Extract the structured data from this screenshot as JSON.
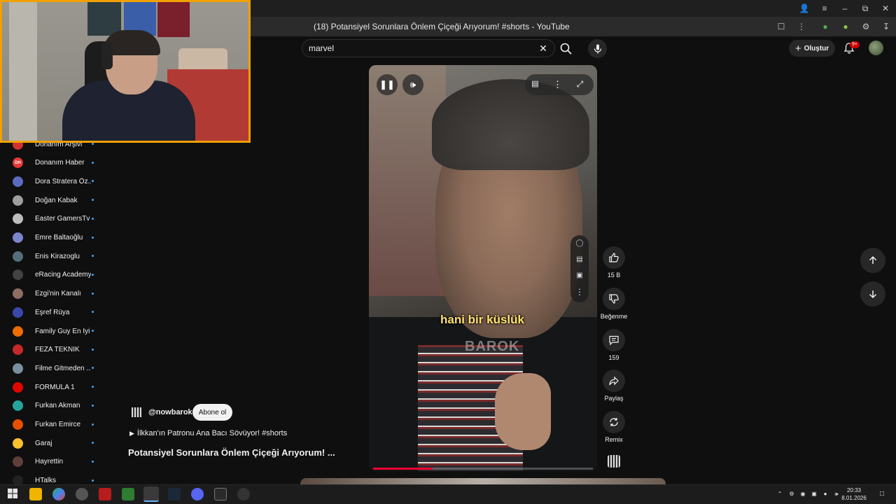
{
  "browser": {
    "page_title": "(18) Potansiyel Sorunlara Önlem Çiçeği Arıyorum! #shorts - YouTube"
  },
  "header": {
    "search_value": "marvel",
    "create_label": "Oluştur",
    "notification_badge": "9+"
  },
  "sidebar": {
    "items": [
      {
        "label": "Donanım Arşivi",
        "color": "#d32f2f",
        "initials": ""
      },
      {
        "label": "Donanım Haber",
        "color": "#e53935",
        "initials": "DH"
      },
      {
        "label": "Dora Stratera Öz...",
        "color": "#5c6bc0",
        "initials": ""
      },
      {
        "label": "Doğan Kabak",
        "color": "#9e9e9e",
        "initials": ""
      },
      {
        "label": "Easter GamersTv",
        "color": "#bdbdbd",
        "initials": ""
      },
      {
        "label": "Emre Baltaoğlu",
        "color": "#7986cb",
        "initials": ""
      },
      {
        "label": "Enis Kirazoglu",
        "color": "#546e7a",
        "initials": ""
      },
      {
        "label": "eRacing Academy",
        "color": "#424242",
        "initials": ""
      },
      {
        "label": "Ezgi'nin Kanalı",
        "color": "#8d6e63",
        "initials": ""
      },
      {
        "label": "Eşref Rüya",
        "color": "#3949ab",
        "initials": ""
      },
      {
        "label": "Family Guy En İyi K...",
        "color": "#ef6c00",
        "initials": ""
      },
      {
        "label": "FEZA TEKNIK",
        "color": "#c62828",
        "initials": ""
      },
      {
        "label": "Filme Gitmeden ...",
        "color": "#78909c",
        "initials": ""
      },
      {
        "label": "FORMULA 1",
        "color": "#e10600",
        "initials": ""
      },
      {
        "label": "Furkan Akman",
        "color": "#26a69a",
        "initials": ""
      },
      {
        "label": "Furkan Emirce",
        "color": "#e65100",
        "initials": ""
      },
      {
        "label": "Garaj",
        "color": "#fbc02d",
        "initials": ""
      },
      {
        "label": "Hayrettin",
        "color": "#5d4037",
        "initials": ""
      },
      {
        "label": "HTalks",
        "color": "#212121",
        "initials": ""
      }
    ]
  },
  "video": {
    "caption": "hani bir küslük",
    "watermark": "BAROK",
    "progress_fraction": 0.27
  },
  "actions": {
    "like_count": "15 B",
    "dislike_label": "Beğenme",
    "comment_count": "159",
    "share_label": "Paylaş",
    "remix_label": "Remix"
  },
  "channel": {
    "handle": "@nowbarok",
    "subscribe_label": "Abone ol",
    "playlist_title": "İlkkan'ın Patronu Ana Bacı Sövüyor! #shorts",
    "video_title": "Potansiyel Sorunlara Önlem Çiçeği Arıyorum! ..."
  },
  "taskbar": {
    "time": "20:33",
    "date": "8.01.2026"
  }
}
